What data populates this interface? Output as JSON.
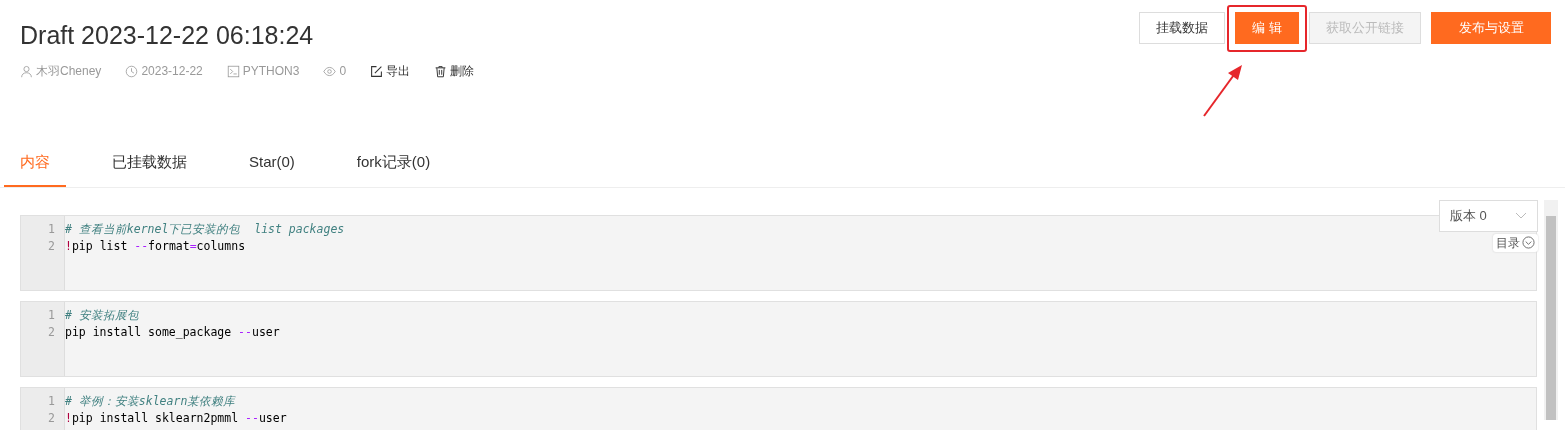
{
  "title": "Draft 2023-12-22 06:18:24",
  "meta": [
    {
      "kind": "user",
      "text": "木羽Cheney"
    },
    {
      "kind": "clock",
      "text": "2023-12-22"
    },
    {
      "kind": "terminal",
      "text": "PYTHON3"
    },
    {
      "kind": "eye",
      "text": "0"
    },
    {
      "kind": "edit",
      "text": "导出"
    },
    {
      "kind": "trash",
      "text": "删除"
    }
  ],
  "buttons": [
    {
      "label": "挂载数据",
      "kind": "outline",
      "disabled": false,
      "highlighted": false
    },
    {
      "label": "编 辑",
      "kind": "primary",
      "disabled": false,
      "highlighted": true
    },
    {
      "label": "获取公开链接",
      "kind": "outline",
      "disabled": true,
      "highlighted": false
    },
    {
      "label": "发布与设置",
      "kind": "primary",
      "disabled": false,
      "highlighted": false
    }
  ],
  "tabs": [
    {
      "label": "内容",
      "selected": true
    },
    {
      "label": "已挂载数据",
      "selected": false
    },
    {
      "label": "Star(0)",
      "selected": false
    },
    {
      "label": "fork记录(0)",
      "selected": false
    }
  ],
  "version_select": {
    "value": "版本 0"
  },
  "toc_button": {
    "label": "目录"
  },
  "cells": [
    {
      "lines": [
        {
          "number": "1",
          "tokens": [
            {
              "kind": "comment",
              "text": "# 查看当前kernel下已安装的包  list packages"
            }
          ]
        },
        {
          "number": "2",
          "tokens": [
            {
              "kind": "bang",
              "text": "!"
            },
            {
              "kind": "plain",
              "text": "pip list "
            },
            {
              "kind": "operator",
              "text": "--"
            },
            {
              "kind": "plain",
              "text": "format"
            },
            {
              "kind": "operator",
              "text": "="
            },
            {
              "kind": "plain",
              "text": "columns"
            }
          ]
        }
      ]
    },
    {
      "lines": [
        {
          "number": "1",
          "tokens": [
            {
              "kind": "comment",
              "text": "# 安装拓展包"
            }
          ]
        },
        {
          "number": "2",
          "tokens": [
            {
              "kind": "plain",
              "text": "pip install some_package "
            },
            {
              "kind": "operator",
              "text": "--"
            },
            {
              "kind": "plain",
              "text": "user"
            }
          ]
        }
      ]
    },
    {
      "lines": [
        {
          "number": "1",
          "tokens": [
            {
              "kind": "comment",
              "text": "# 举例：安装sklearn某依赖库"
            }
          ]
        },
        {
          "number": "2",
          "tokens": [
            {
              "kind": "bang",
              "text": "!"
            },
            {
              "kind": "plain",
              "text": "pip install sklearn2pmml "
            },
            {
              "kind": "operator",
              "text": "--"
            },
            {
              "kind": "plain",
              "text": "user"
            }
          ]
        }
      ]
    }
  ]
}
